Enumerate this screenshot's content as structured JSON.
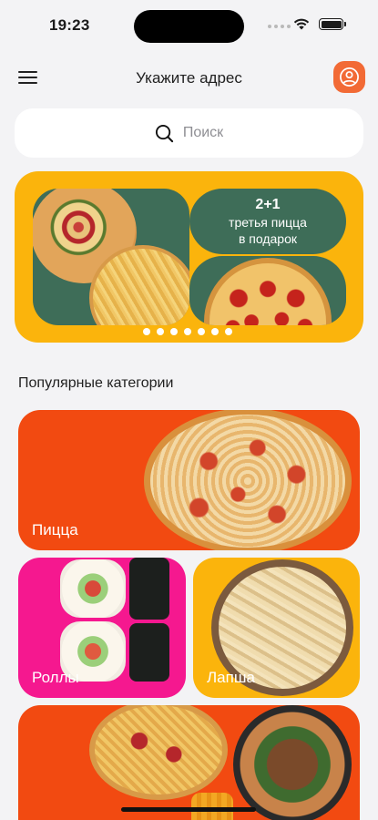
{
  "status_bar": {
    "time": "19:23"
  },
  "header": {
    "title": "Укажите адрес"
  },
  "search": {
    "placeholder": "Поиск"
  },
  "banner": {
    "promo_title": "2+1",
    "promo_line1": "третья пицца",
    "promo_line2": "в подарок",
    "slide_count": 7
  },
  "section": {
    "title": "Популярные категории"
  },
  "categories": [
    {
      "label": "Пицца"
    },
    {
      "label": "Роллы"
    },
    {
      "label": "Лапша"
    }
  ],
  "colors": {
    "accent": "#f26a35",
    "orange_card": "#f24a11",
    "pink_card": "#f5188f",
    "yellow": "#fbb40c",
    "green": "#3e6d58"
  }
}
